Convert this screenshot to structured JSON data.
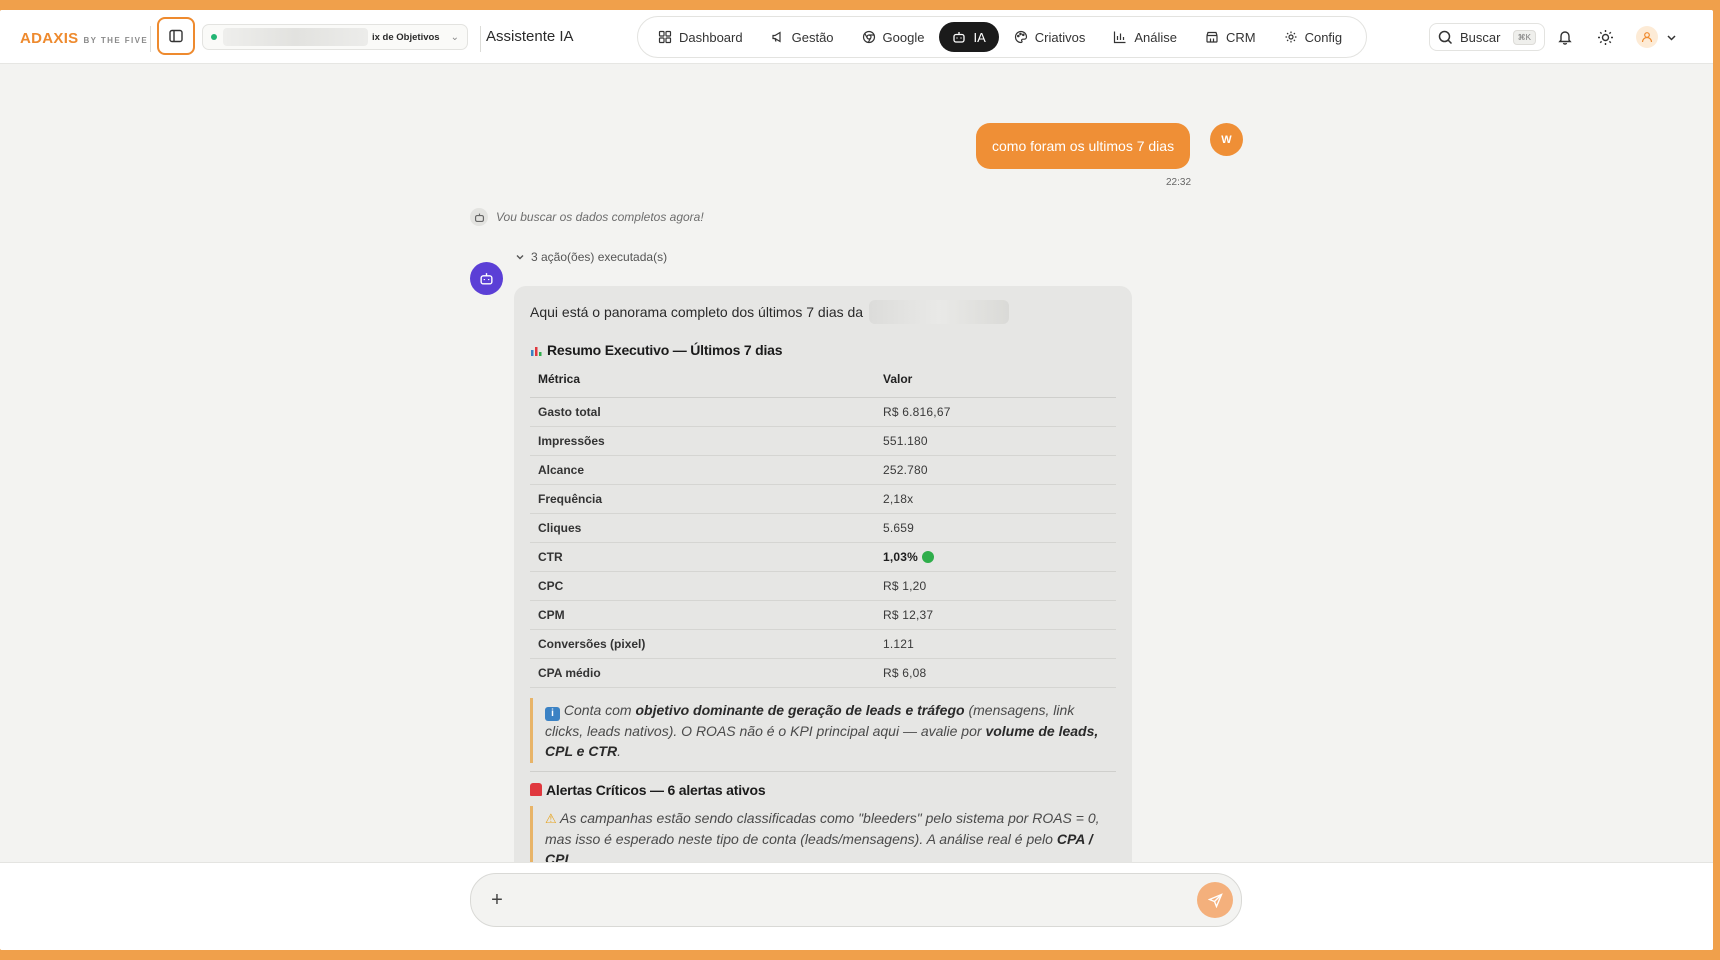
{
  "brand": {
    "name": "ADAXIS",
    "tagline": "BY THE FIVE",
    "accent": "#ee8a2e"
  },
  "header": {
    "account": {
      "name": "ix de Objetivos"
    },
    "page_title": "Assistente IA"
  },
  "nav": {
    "items": [
      {
        "label": "Dashboard",
        "icon": "dashboard-icon"
      },
      {
        "label": "Gestão",
        "icon": "megaphone-icon"
      },
      {
        "label": "Google",
        "icon": "google-icon"
      },
      {
        "label": "IA",
        "icon": "bot-icon",
        "active": true
      },
      {
        "label": "Criativos",
        "icon": "palette-icon"
      },
      {
        "label": "Análise",
        "icon": "bar-chart-icon"
      },
      {
        "label": "CRM",
        "icon": "crm-icon"
      },
      {
        "label": "Config",
        "icon": "gear-icon"
      }
    ]
  },
  "search": {
    "label": "Buscar",
    "shortcut": "⌘K"
  },
  "chat": {
    "user_message": {
      "text": "como foram os ultimos 7 dias",
      "time": "22:32",
      "avatar_initial": "W"
    },
    "status": "Vou buscar os dados completos agora!",
    "actions_summary": "3 ação(ões) executada(s)",
    "reply": {
      "intro": "Aqui está o panorama completo dos últimos 7 dias da",
      "summary_title": "Resumo Executivo — Últimos 7 dias",
      "table": {
        "headers": [
          "Métrica",
          "Valor"
        ],
        "rows": [
          [
            "Gasto total",
            "R$ 6.816,67"
          ],
          [
            "Impressões",
            "551.180"
          ],
          [
            "Alcance",
            "252.780"
          ],
          [
            "Frequência",
            "2,18x"
          ],
          [
            "Cliques",
            "5.659"
          ],
          [
            "CTR",
            "1,03%"
          ],
          [
            "CPC",
            "R$ 1,20"
          ],
          [
            "CPM",
            "R$ 12,37"
          ],
          [
            "Conversões (pixel)",
            "1.121"
          ],
          [
            "CPA médio",
            "R$ 6,08"
          ]
        ]
      },
      "note": {
        "p1": "Conta com",
        "b1": "objetivo dominante de geração de leads e tráfego",
        "p2": "(mensagens, link clicks, leads nativos). O ROAS não é o KPI principal aqui — avalie por",
        "b2": "volume de leads, CPL e CTR",
        "p3": "."
      },
      "alerts_title": "Alertas Críticos — 6 alertas ativos",
      "alert": {
        "p1": "As campanhas estão sendo classificadas como \"bleeders\" pelo sistema por ROAS = 0, mas isso é esperado neste tipo de conta (leads/mensagens). A análise real é pelo",
        "b1": "CPA / CPL",
        "p2": "."
      }
    }
  },
  "composer": {
    "placeholder": ""
  }
}
